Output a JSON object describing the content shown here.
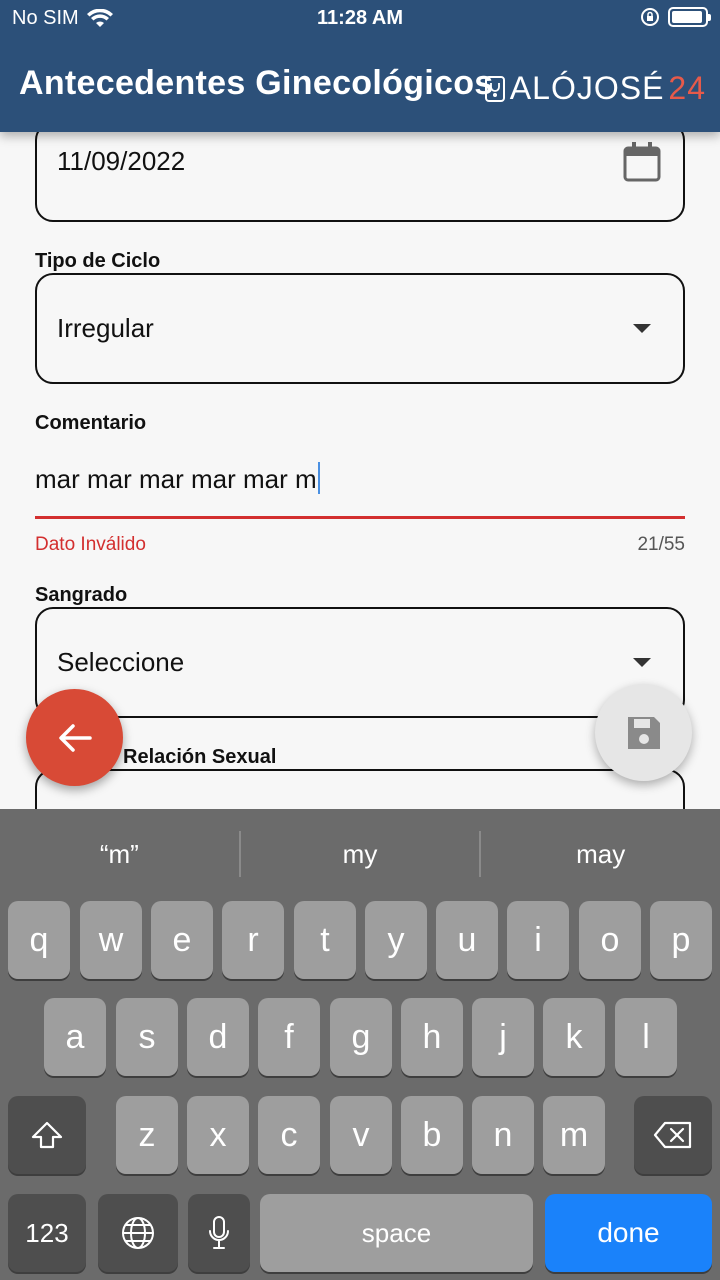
{
  "status_bar": {
    "carrier": "No SIM",
    "time": "11:28 AM"
  },
  "app_bar": {
    "title": "Antecedentes Ginecológicos",
    "logo_main": "ALÓJOSÉ",
    "logo_num": "24"
  },
  "form": {
    "date_value": "11/09/2022",
    "cycle_label": "Tipo de Ciclo",
    "cycle_value": "Irregular",
    "comment_label": "Comentario",
    "comment_value": "mar mar mar mar mar m",
    "comment_error": "Dato Inválido",
    "comment_counter": "21/55",
    "bleeding_label": "Sangrado",
    "bleeding_value": "Seleccione",
    "sexual_label": "Relación Sexual"
  },
  "keyboard": {
    "suggestions": [
      "“m”",
      "my",
      "may"
    ],
    "row1": [
      "q",
      "w",
      "e",
      "r",
      "t",
      "y",
      "u",
      "i",
      "o",
      "p"
    ],
    "row2": [
      "a",
      "s",
      "d",
      "f",
      "g",
      "h",
      "j",
      "k",
      "l"
    ],
    "row3": [
      "z",
      "x",
      "c",
      "v",
      "b",
      "n",
      "m"
    ],
    "numbers_label": "123",
    "space_label": "space",
    "done_label": "done"
  },
  "colors": {
    "app_bar": "#2c5079",
    "error": "#d32f2f",
    "back_fab": "#d84a36",
    "done_key": "#1a82fa"
  }
}
